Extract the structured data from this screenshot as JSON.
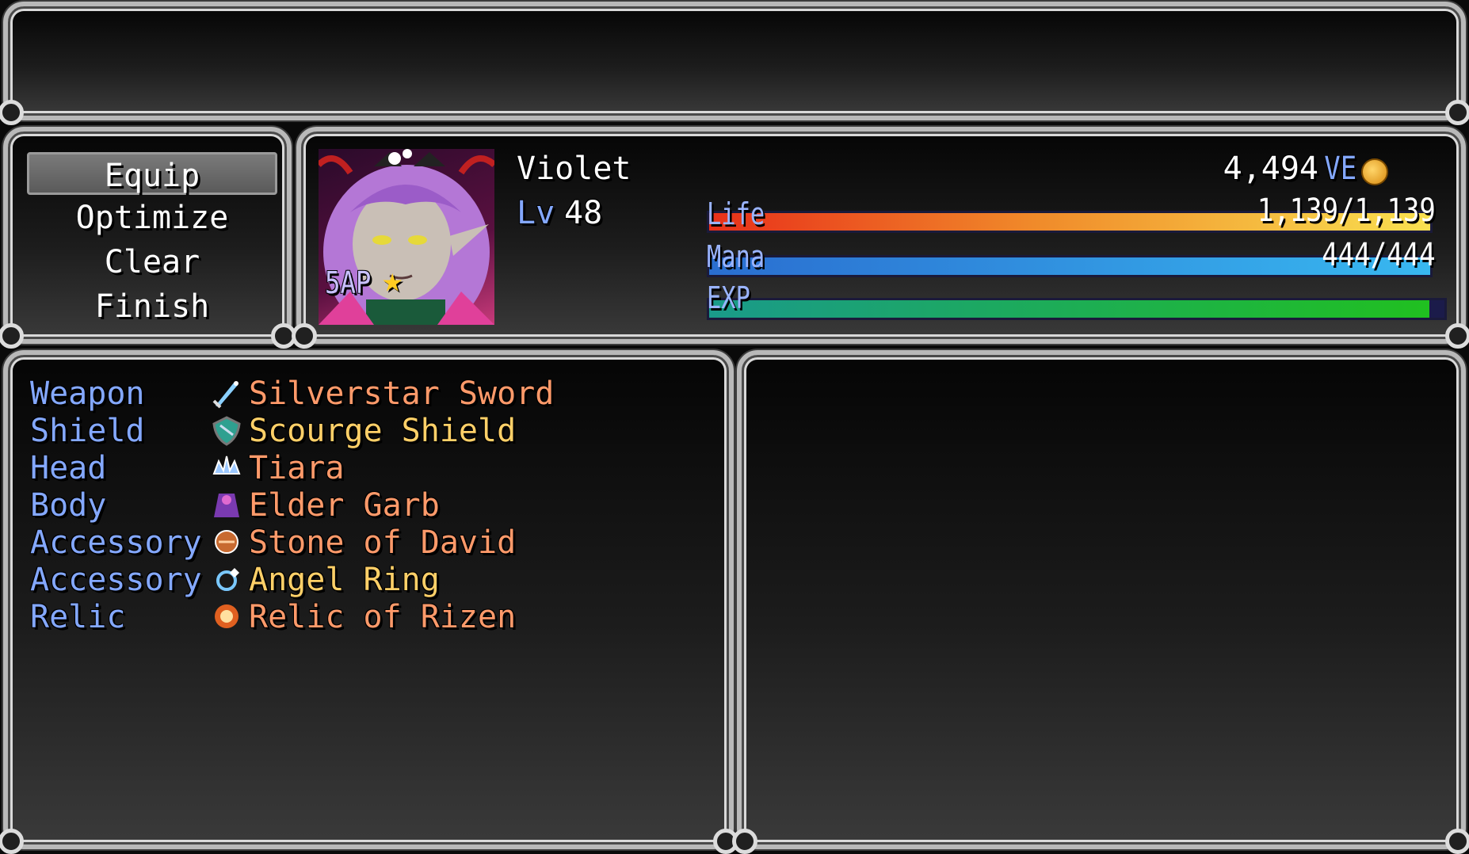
{
  "commands": [
    {
      "label": "Equip",
      "selected": true
    },
    {
      "label": "Optimize",
      "selected": false
    },
    {
      "label": "Clear",
      "selected": false
    },
    {
      "label": "Finish",
      "selected": false
    }
  ],
  "actor": {
    "name": "Violet",
    "level_label": "Lv",
    "level": "48",
    "ap_badge": "5AP",
    "currency_amount": "4,494",
    "currency_unit": "VE",
    "life_label": "Life",
    "life_value": "1,139/1,139",
    "life_fraction": 1.0,
    "mana_label": "Mana",
    "mana_value": "444/444",
    "mana_fraction": 1.0,
    "exp_label": "EXP",
    "exp_fraction": 0.98
  },
  "equipment": [
    {
      "slot": "Weapon",
      "item": "Silverstar Sword",
      "color": "#ff9a6a",
      "icon": "sword-icon"
    },
    {
      "slot": "Shield",
      "item": "Scourge Shield",
      "color": "#ffd068",
      "icon": "shield-icon"
    },
    {
      "slot": "Head",
      "item": "Tiara",
      "color": "#ff9a6a",
      "icon": "tiara-icon"
    },
    {
      "slot": "Body",
      "item": "Elder Garb",
      "color": "#ff9a6a",
      "icon": "garb-icon"
    },
    {
      "slot": "Accessory",
      "item": "Stone of David",
      "color": "#ff9a6a",
      "icon": "stone-icon"
    },
    {
      "slot": "Accessory",
      "item": "Angel Ring",
      "color": "#ffd068",
      "icon": "ring-icon"
    },
    {
      "slot": "Relic",
      "item": "Relic of Rizen",
      "color": "#ff9a6a",
      "icon": "relic-icon"
    }
  ],
  "colors": {
    "slot_label": "#84a8ff",
    "life_gradient": [
      "#e8301a",
      "#f9e050"
    ],
    "mana_gradient": [
      "#2a6ed0",
      "#38b8f0"
    ],
    "exp_gradient": [
      "#1a9a8a",
      "#20c020"
    ]
  }
}
